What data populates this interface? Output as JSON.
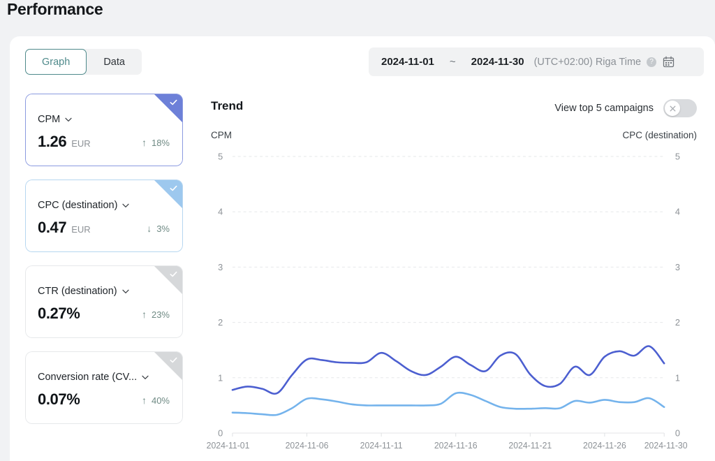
{
  "page": {
    "title": "Performance"
  },
  "toolbar": {
    "tabs": [
      {
        "label": "Graph",
        "active": true
      },
      {
        "label": "Data",
        "active": false
      }
    ],
    "daterange": {
      "start": "2024-11-01",
      "separator": "~",
      "end": "2024-11-30",
      "timezone": "(UTC+02:00) Riga Time",
      "help_icon": "help-circle-icon",
      "calendar_icon": "calendar-icon"
    }
  },
  "cards": [
    {
      "label": "CPM",
      "value": "1.26",
      "unit": "EUR",
      "delta": "18%",
      "direction": "up",
      "arrow": "↑",
      "selected": true,
      "corner_color": "#6d80d8",
      "border_color": "#8b9ae0",
      "state": "sel1"
    },
    {
      "label": "CPC (destination)",
      "value": "0.47",
      "unit": "EUR",
      "delta": "3%",
      "direction": "down",
      "arrow": "↓",
      "selected": true,
      "corner_color": "#9dc8ee",
      "border_color": "#b6d6f0",
      "state": "sel2"
    },
    {
      "label": "CTR (destination)",
      "value": "0.27%",
      "unit": "",
      "delta": "23%",
      "direction": "up",
      "arrow": "↑",
      "selected": false,
      "corner_color": "#d6d8da",
      "border_color": "#e6e8ea",
      "state": "unsel"
    },
    {
      "label": "Conversion rate (CV...",
      "value": "0.07%",
      "unit": "",
      "delta": "40%",
      "direction": "up",
      "arrow": "↑",
      "selected": false,
      "corner_color": "#d6d8da",
      "border_color": "#e6e8ea",
      "state": "unsel"
    }
  ],
  "chart_header": {
    "title": "Trend",
    "toggle_label": "View top 5 campaigns",
    "toggle_on": false,
    "toggle_icon": "close-x-icon",
    "left_axis_label": "CPM",
    "right_axis_label": "CPC (destination)"
  },
  "chart_data": {
    "type": "line",
    "title": "Trend",
    "xlabel": "",
    "ylabel": "CPM",
    "y2label": "CPC (destination)",
    "ylim": [
      0,
      5
    ],
    "y2lim": [
      0,
      5
    ],
    "yticks": [
      0,
      1,
      2,
      3,
      4,
      5
    ],
    "y2ticks": [
      0,
      1,
      2,
      3,
      4,
      5
    ],
    "grid": true,
    "legend": "none",
    "x": [
      "2024-11-01",
      "2024-11-02",
      "2024-11-03",
      "2024-11-04",
      "2024-11-05",
      "2024-11-06",
      "2024-11-07",
      "2024-11-08",
      "2024-11-09",
      "2024-11-10",
      "2024-11-11",
      "2024-11-12",
      "2024-11-13",
      "2024-11-14",
      "2024-11-15",
      "2024-11-16",
      "2024-11-17",
      "2024-11-18",
      "2024-11-19",
      "2024-11-20",
      "2024-11-21",
      "2024-11-22",
      "2024-11-23",
      "2024-11-24",
      "2024-11-25",
      "2024-11-26",
      "2024-11-27",
      "2024-11-28",
      "2024-11-29",
      "2024-11-30"
    ],
    "xticklabels": [
      "2024-11-01",
      "2024-11-06",
      "2024-11-11",
      "2024-11-16",
      "2024-11-21",
      "2024-11-26",
      "2024-11-30"
    ],
    "series": [
      {
        "name": "CPM",
        "axis": "left",
        "color": "#4c5fd0",
        "values": [
          0.78,
          0.84,
          0.8,
          0.72,
          1.05,
          1.33,
          1.32,
          1.28,
          1.27,
          1.28,
          1.45,
          1.3,
          1.12,
          1.05,
          1.2,
          1.38,
          1.23,
          1.12,
          1.4,
          1.43,
          1.06,
          0.85,
          0.89,
          1.2,
          1.05,
          1.38,
          1.48,
          1.4,
          1.57,
          1.26
        ]
      },
      {
        "name": "CPC (destination)",
        "axis": "right",
        "color": "#74b3ec",
        "values": [
          0.37,
          0.36,
          0.34,
          0.33,
          0.45,
          0.62,
          0.61,
          0.57,
          0.52,
          0.5,
          0.5,
          0.5,
          0.5,
          0.5,
          0.53,
          0.72,
          0.69,
          0.58,
          0.47,
          0.44,
          0.44,
          0.45,
          0.45,
          0.58,
          0.55,
          0.6,
          0.56,
          0.56,
          0.63,
          0.47
        ]
      }
    ]
  }
}
